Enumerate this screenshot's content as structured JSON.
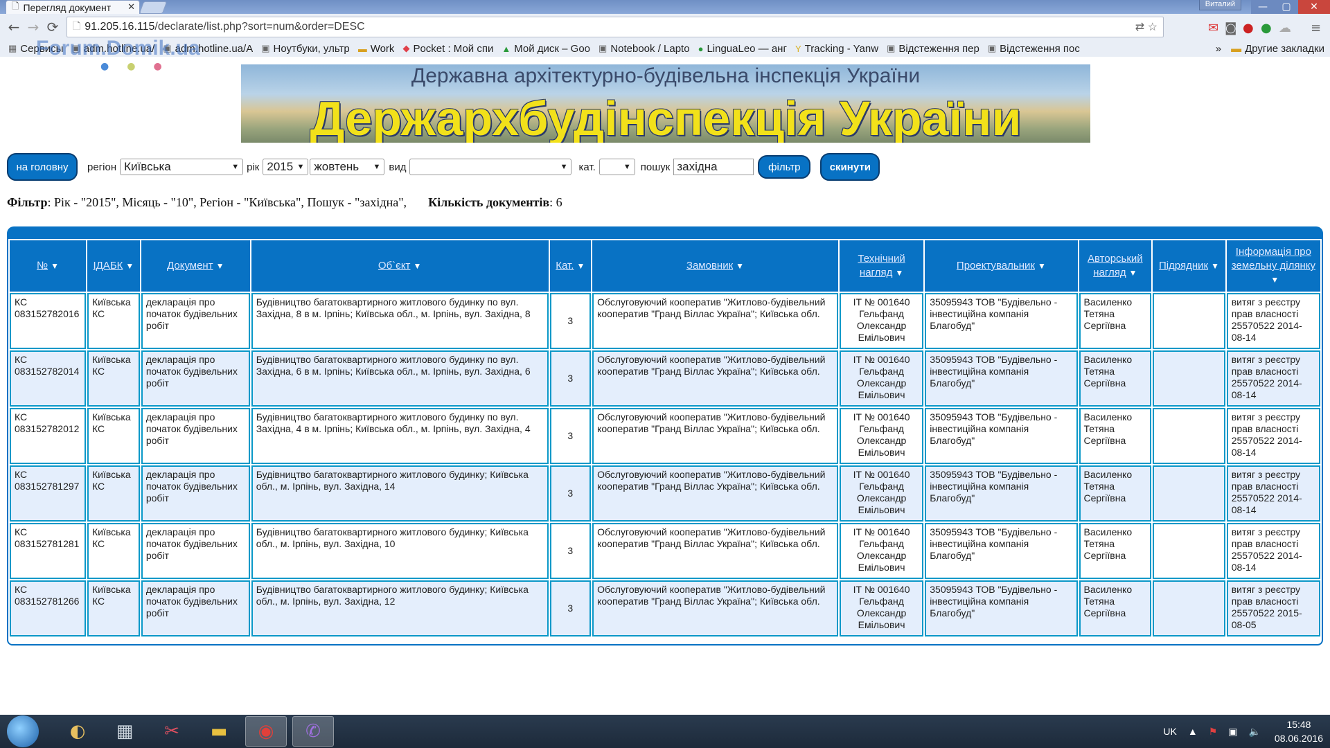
{
  "browser": {
    "tab_title": "Перегляд документ",
    "username": "Виталий",
    "url_host": "91.205.16.115",
    "url_path": "/declarate/list.php?sort=num&order=DESC",
    "bookmarks": [
      {
        "icon": "apps-icon",
        "label": "Сервисы"
      },
      {
        "icon": "page-icon",
        "label": "adm.hotline.ua/"
      },
      {
        "icon": "page-icon",
        "label": "adm.hotline.ua/A"
      },
      {
        "icon": "page-icon",
        "label": "Ноутбуки, ультр"
      },
      {
        "icon": "folder-icon",
        "label": "Work"
      },
      {
        "icon": "pocket-icon",
        "label": "Pocket : Мой спи"
      },
      {
        "icon": "drive-icon",
        "label": "Мой диск – Goo"
      },
      {
        "icon": "page-icon",
        "label": "Notebook / Lapto"
      },
      {
        "icon": "lingualeo-icon",
        "label": "LinguaLeo — анг"
      },
      {
        "icon": "yandex-icon",
        "label": "Tracking - Yanw"
      },
      {
        "icon": "page-icon",
        "label": "Відстеження пер"
      },
      {
        "icon": "page-icon",
        "label": "Відстеження пос"
      }
    ],
    "other_bookmarks": "Другие закладки"
  },
  "watermark": "Forum.Domik.ua",
  "banner": {
    "line1": "Державна архітектурно-будівельна інспекція України",
    "line2": "Держархбудінспекція України"
  },
  "filter": {
    "home_button": "на головну",
    "region_label": "регіон",
    "region_value": "Київська",
    "year_label": "рік",
    "year_value": "2015",
    "month_value": "жовтень",
    "type_label": "вид",
    "type_value": "",
    "cat_label": "кат.",
    "cat_value": "",
    "search_label": "пошук",
    "search_value": "західна",
    "filter_button": "фільтр",
    "reset_button": "скинути"
  },
  "filter_info": {
    "label": "Фільтр",
    "text": ": Рік - \"2015\", Місяць - \"10\", Регіон - \"Київська\", Пошук - \"західна\",",
    "count_label": "Кількість документів",
    "count_value": ": 6"
  },
  "table": {
    "columns": [
      "№",
      "ІДАБК",
      "Документ",
      "Об`єкт",
      "Кат.",
      "Замовник",
      "Технічний нагляд",
      "Проектувальник",
      "Авторський нагляд",
      "Підрядник",
      "Інформація про земельну ділянку"
    ],
    "rows": [
      [
        "КС 083152782016",
        "Київська КС",
        "декларація про початок будівельних робіт",
        "Будівництво багатоквартирного житлового будинку по вул. Західна, 8 в м. Ірпінь; Київська обл., м. Ірпінь, вул. Західна, 8",
        "3",
        "Обслуговуючий кооператив \"Житлово-будівельний кооператив \"Гранд Віллас Україна\"; Київська обл.",
        "ІТ № 001640 Гельфанд Олександр Емільович",
        "35095943 ТОВ \"Будівельно - інвестиційна компанія Благобуд\"",
        "Василенко Тетяна Сергіївна",
        "",
        "витяг з реєстру прав власності 25570522 2014-08-14"
      ],
      [
        "КС 083152782014",
        "Київська КС",
        "декларація про початок будівельних робіт",
        "Будівництво багатоквартирного житлового будинку по вул. Західна, 6 в м. Ірпінь; Київська обл., м. Ірпінь, вул. Західна, 6",
        "3",
        "Обслуговуючий кооператив \"Житлово-будівельний кооператив \"Гранд Віллас Україна\"; Київська обл.",
        "ІТ № 001640 Гельфанд Олександр Емільович",
        "35095943 ТОВ \"Будівельно - інвестиційна компанія Благобуд\"",
        "Василенко Тетяна Сергіївна",
        "",
        "витяг з реєстру прав власності 25570522 2014-08-14"
      ],
      [
        "КС 083152782012",
        "Київська КС",
        "декларація про початок будівельних робіт",
        "Будівництво багатоквартирного житлового будинку по вул. Західна, 4 в м. Ірпінь; Київська обл., м. Ірпінь, вул. Західна, 4",
        "3",
        "Обслуговуючий кооператив \"Житлово-будівельний кооператив \"Гранд Віллас Україна\"; Київська обл.",
        "ІТ № 001640 Гельфанд Олександр Емільович",
        "35095943 ТОВ \"Будівельно - інвестиційна компанія Благобуд\"",
        "Василенко Тетяна Сергіївна",
        "",
        "витяг з реєстру прав власності 25570522 2014-08-14"
      ],
      [
        "КС 083152781297",
        "Київська КС",
        "декларація про початок будівельних робіт",
        "Будівництво багатоквартирного житлового будинку; Київська обл., м. Ірпінь, вул. Західна, 14",
        "3",
        "Обслуговуючий кооператив \"Житлово-будівельний кооператив \"Гранд Віллас Україна\"; Київська обл.",
        "ІТ № 001640 Гельфанд Олександр Емільович",
        "35095943 ТОВ \"Будівельно - інвестиційна компанія Благобуд\"",
        "Василенко Тетяна Сергіївна",
        "",
        "витяг з реєстру прав власності 25570522 2014-08-14"
      ],
      [
        "КС 083152781281",
        "Київська КС",
        "декларація про початок будівельних робіт",
        "Будівництво багатоквартирного житлового будинку; Київська обл., м. Ірпінь, вул. Західна, 10",
        "3",
        "Обслуговуючий кооператив \"Житлово-будівельний кооператив \"Гранд Віллас Україна\"; Київська обл.",
        "ІТ № 001640 Гельфанд Олександр Емільович",
        "35095943 ТОВ \"Будівельно - інвестиційна компанія Благобуд\"",
        "Василенко Тетяна Сергіївна",
        "",
        "витяг з реєстру прав власності 25570522 2014-08-14"
      ],
      [
        "КС 083152781266",
        "Київська КС",
        "декларація про початок будівельних робіт",
        "Будівництво багатоквартирного житлового будинку; Київська обл., м. Ірпінь, вул. Західна, 12",
        "3",
        "Обслуговуючий кооператив \"Житлово-будівельний кооператив \"Гранд Віллас Україна\"; Київська обл.",
        "ІТ № 001640 Гельфанд Олександр Емільович",
        "35095943 ТОВ \"Будівельно - інвестиційна компанія Благобуд\"",
        "Василенко Тетяна Сергіївна",
        "",
        "витяг з реєстру прав власності 25570522 2015-08-05"
      ]
    ]
  },
  "taskbar": {
    "language": "UK",
    "time": "15:48",
    "date": "08.06.2016"
  },
  "colors": {
    "accent": "#0872c4",
    "row_alt": "#e4eefc",
    "cell_border": "#0a98c8"
  }
}
